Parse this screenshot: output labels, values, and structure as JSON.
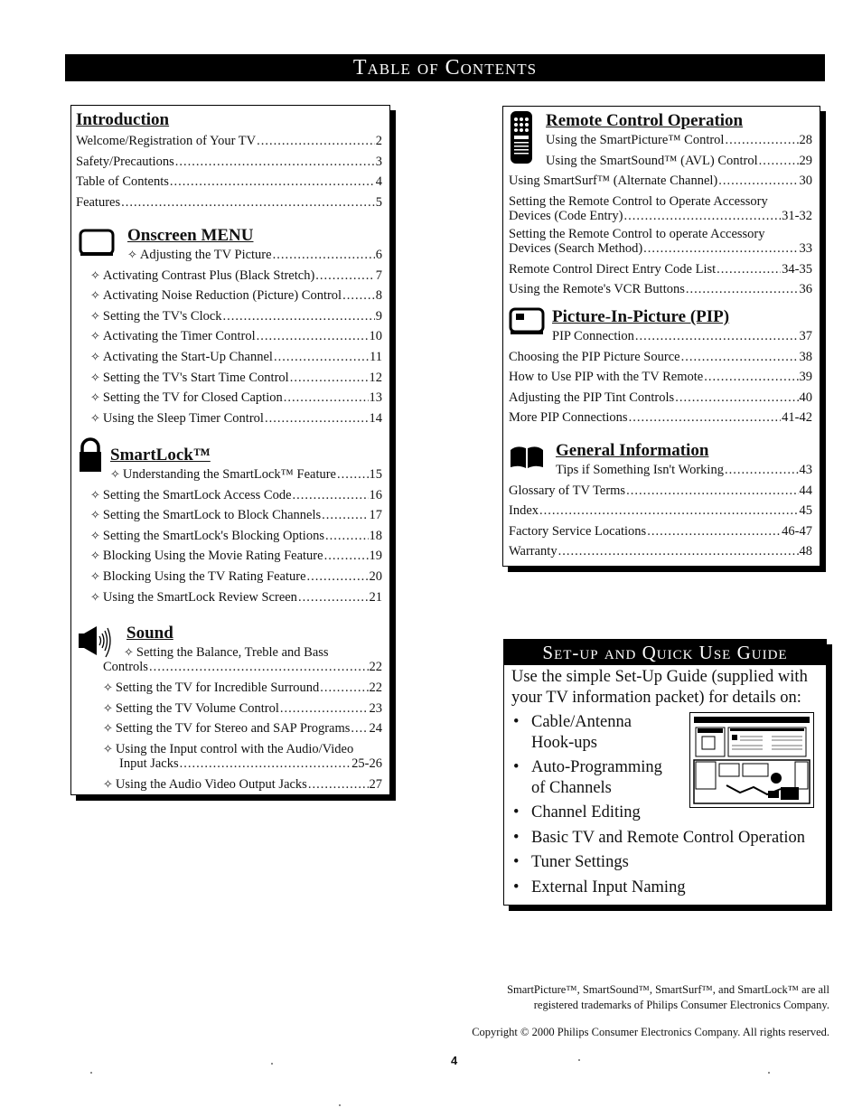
{
  "banner": {
    "title": "Table of Contents"
  },
  "introduction": {
    "title": "Introduction",
    "items": [
      {
        "label": "Welcome/Registration of Your TV",
        "page": "2"
      },
      {
        "label": "Safety/Precautions",
        "page": "3"
      },
      {
        "label": "Table of Contents",
        "page": "4"
      },
      {
        "label": "Features",
        "page": "5"
      }
    ]
  },
  "onscreen_menu": {
    "title": "Onscreen MENU",
    "icon": "tv-screen-icon",
    "bullet": "✧",
    "items": [
      {
        "label": "Adjusting the TV Picture",
        "page": "6"
      },
      {
        "label": "Activating Contrast Plus (Black Stretch)",
        "page": "7"
      },
      {
        "label": "Activating Noise Reduction (Picture) Control",
        "page": "8"
      },
      {
        "label": "Setting the TV's Clock",
        "page": "9"
      },
      {
        "label": "Activating the Timer Control",
        "page": "10"
      },
      {
        "label": "Activating the Start-Up Channel",
        "page": "11"
      },
      {
        "label": "Setting the TV's Start Time Control",
        "page": "12"
      },
      {
        "label": "Setting the TV for Closed Caption",
        "page": "13"
      },
      {
        "label": "Using the Sleep Timer Control",
        "page": "14"
      }
    ]
  },
  "smartlock": {
    "title": "SmartLock™",
    "icon": "padlock-icon",
    "items": [
      {
        "label": "Understanding the SmartLock™ Feature",
        "page": "15"
      },
      {
        "label": "Setting the SmartLock Access Code",
        "page": "16"
      },
      {
        "label": "Setting the SmartLock  to Block Channels",
        "page": "17"
      },
      {
        "label": "Setting the SmartLock's Blocking Options",
        "page": "18"
      },
      {
        "label": "Blocking Using the Movie Rating Feature",
        "page": "19"
      },
      {
        "label": "Blocking Using the TV Rating Feature",
        "page": "20"
      },
      {
        "label": "Using the SmartLock Review Screen",
        "page": "21"
      }
    ]
  },
  "sound": {
    "title": "Sound",
    "icon": "speaker-icon",
    "items": [
      {
        "label": "Setting the Balance, Treble and Bass",
        "label2": "Controls",
        "page": "22"
      },
      {
        "label": "Setting the TV for Incredible Surround",
        "page": "22"
      },
      {
        "label": "Setting the TV Volume Control",
        "page": "23"
      },
      {
        "label": "Setting the TV for Stereo and SAP Programs",
        "page": "24"
      },
      {
        "label": "Using the Input control with the Audio/Video",
        "label2": "Input Jacks",
        "page": "25-26"
      },
      {
        "label": "Using the Audio Video Output Jacks",
        "page": "27"
      }
    ]
  },
  "remote": {
    "title": "Remote Control Operation",
    "icon": "remote-control-icon",
    "items": [
      {
        "label": "Using the SmartPicture™ Control",
        "page": "28"
      },
      {
        "label": "Using the SmartSound™ (AVL) Control",
        "page": "29"
      },
      {
        "label": "Using SmartSurf™ (Alternate Channel)",
        "page": "30"
      },
      {
        "label": "Setting the Remote Control to Operate Accessory",
        "label2": "Devices (Code Entry)",
        "page": "31-32"
      },
      {
        "label": "Setting the Remote Control to operate Accessory",
        "label2": "Devices (Search Method)",
        "page": "33"
      },
      {
        "label": "Remote Control Direct Entry Code List",
        "page": "34-35"
      },
      {
        "label": "Using the Remote's VCR Buttons",
        "page": "36"
      }
    ]
  },
  "pip": {
    "title": "Picture-In-Picture (PIP)",
    "icon": "pip-screen-icon",
    "items": [
      {
        "label": "PIP Connection",
        "page": "37"
      },
      {
        "label": "Choosing the PIP Picture Source",
        "page": "38"
      },
      {
        "label": "How to Use PIP with the TV Remote",
        "page": "39"
      },
      {
        "label": "Adjusting the PIP Tint Controls",
        "page": "40"
      },
      {
        "label": "More PIP Connections",
        "page": "41-42"
      }
    ]
  },
  "general": {
    "title": "General Information",
    "icon": "open-book-icon",
    "items": [
      {
        "label": "Tips if Something Isn't Working",
        "page": "43"
      },
      {
        "label": "Glossary of TV Terms",
        "page": "44"
      },
      {
        "label": "Index",
        "page": "45"
      },
      {
        "label": "Factory Service Locations",
        "page": "46-47"
      },
      {
        "label": "Warranty",
        "page": "48"
      }
    ]
  },
  "guide": {
    "title": "Set-up and Quick Use Guide",
    "intro": "Use the simple Set-Up Guide (supplied with your TV information packet) for details on:",
    "bullet": "•",
    "items": [
      "Cable/Antenna Hook-ups",
      "Auto-Programming of Channels",
      "Channel Editing",
      "Basic TV and Remote Control Operation",
      "Tuner Settings",
      "External Input Naming"
    ],
    "thumbnail": "setup-guide-thumbnail"
  },
  "footer": {
    "trademark_line1": "SmartPicture™, SmartSound™, SmartSurf™, and SmartLock™ are all",
    "trademark_line2": "registered trademarks of  Philips Consumer Electronics Company.",
    "copyright": "Copyright © 2000 Philips Consumer Electronics Company. All rights reserved.",
    "page_number": "4"
  }
}
